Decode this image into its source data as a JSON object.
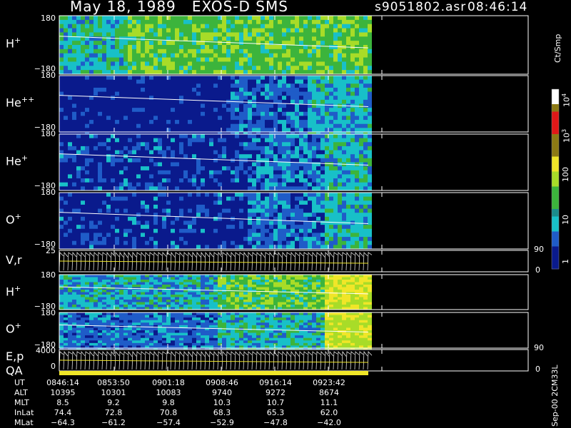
{
  "header": {
    "title": "May 18, 1989   EXOS-D SMS",
    "file": "s9051802.asr",
    "time": "08:46:14"
  },
  "colorbar": {
    "unit": "Ct/Smp",
    "ticks": [
      "10",
      "4",
      "10",
      "3",
      "100",
      "10",
      "1"
    ]
  },
  "panels": [
    {
      "name": "H+",
      "label": "H",
      "sup": "+",
      "ymax": "180",
      "ymin": "−180"
    },
    {
      "name": "He++",
      "label": "He",
      "sup": "++",
      "ymax": "180",
      "ymin": "−180"
    },
    {
      "name": "He+",
      "label": "He",
      "sup": "+",
      "ymax": "180",
      "ymin": "−180"
    },
    {
      "name": "O+",
      "label": "O",
      "sup": "+",
      "ymax": "180",
      "ymin": "−180"
    },
    {
      "name": "V,r",
      "label": "V,r",
      "sup": "",
      "ymax": "25",
      "ymin": "0",
      "right_top": "90",
      "right_bot": "0"
    },
    {
      "name": "H+ (2)",
      "label": "H",
      "sup": "+",
      "ymax": "180",
      "ymin": "−180"
    },
    {
      "name": "O+ (2)",
      "label": "O",
      "sup": "+",
      "ymax": "180",
      "ymin": "−180"
    },
    {
      "name": "E,p",
      "label": "E,p",
      "sup": "",
      "ymax": "4000",
      "ymin": "0",
      "right_top": "90",
      "right_bot": "0"
    }
  ],
  "qa_label": "QA",
  "side_text": "Sep-00 2CM33L",
  "table": {
    "rows": [
      {
        "label": "UT",
        "values": [
          "0846:14",
          "0853:50",
          "0901:18",
          "0908:46",
          "0916:14",
          "0923:42"
        ]
      },
      {
        "label": "ALT",
        "values": [
          "10395",
          "10301",
          "10083",
          "9740",
          "9272",
          "8674"
        ]
      },
      {
        "label": "MLT",
        "values": [
          "8.5",
          "9.2",
          "9.8",
          "10.3",
          "10.7",
          "11.1"
        ]
      },
      {
        "label": "InLat",
        "values": [
          "74.4",
          "72.8",
          "70.8",
          "68.3",
          "65.3",
          "62.0"
        ]
      },
      {
        "label": "MLat",
        "values": [
          "−64.3",
          "−61.2",
          "−57.4",
          "−52.9",
          "−47.8",
          "−42.0"
        ]
      }
    ]
  },
  "chart_data": {
    "type": "heatmap",
    "title": "May 18, 1989   EXOS-D SMS",
    "x_ticks": [
      "0846:14",
      "0853:50",
      "0901:18",
      "0908:46",
      "0916:14",
      "0923:42"
    ],
    "colorbar_range": [
      1,
      10000
    ],
    "colorbar_scale": "log",
    "colors": {
      "low": "#0a1a8c",
      "mid_low": "#1f5cc8",
      "cyan": "#18c0c8",
      "green": "#3cb43c",
      "lime": "#a8dc28",
      "yellow": "#f0e628",
      "olive": "#8c7a14",
      "red": "#e01818",
      "white": "#ffffff"
    }
  }
}
